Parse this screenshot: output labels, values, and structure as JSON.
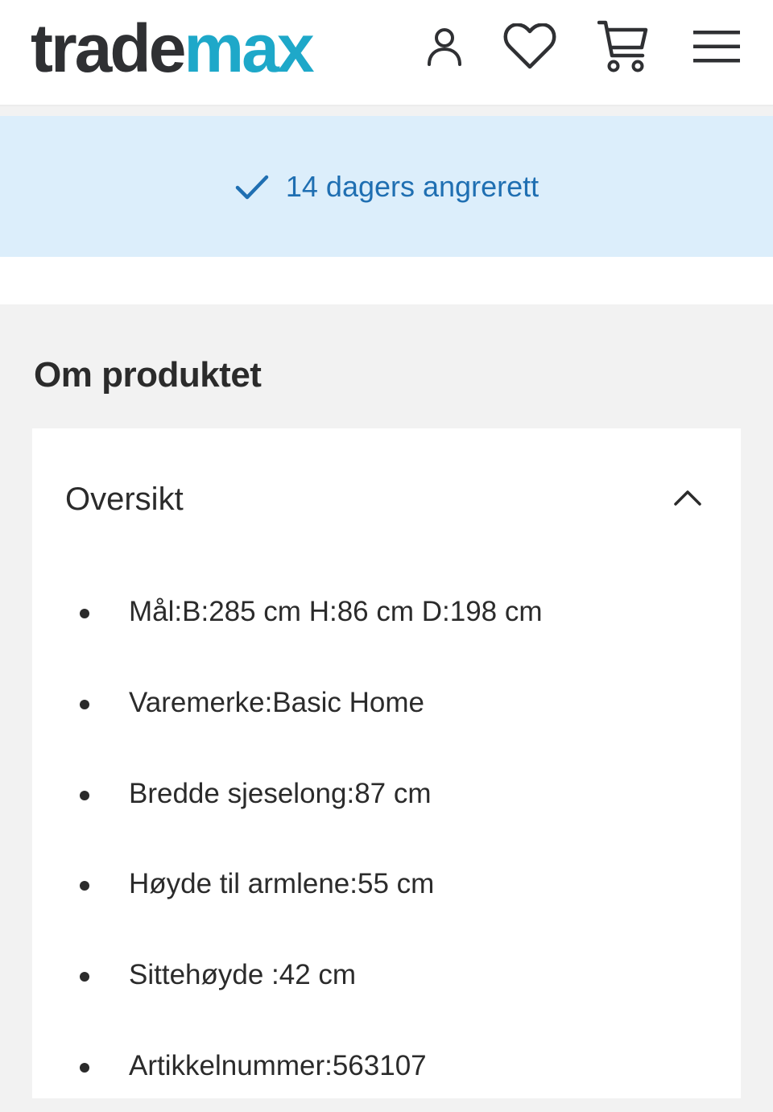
{
  "header": {
    "logo": {
      "part1": "trade",
      "part2": "max"
    },
    "icons": {
      "account": "account-icon",
      "favorites": "heart-icon",
      "cart": "cart-icon",
      "menu": "hamburger-menu-icon"
    }
  },
  "banner": {
    "icon": "checkmark-icon",
    "text": "14 dagers angrerett"
  },
  "main": {
    "section_title": "Om produktet",
    "accordion": {
      "title": "Oversikt",
      "state": "expanded",
      "items": [
        {
          "label": "Mål:B:285 cm H:86 cm D:198 cm"
        },
        {
          "label": "Varemerke:Basic Home"
        },
        {
          "label": "Bredde sjeselong:87 cm"
        },
        {
          "label": "Høyde til armlene:55 cm"
        },
        {
          "label": "Sittehøyde :42 cm"
        },
        {
          "label": "Artikkelnummer:563107"
        }
      ]
    }
  },
  "colors": {
    "brand_dark": "#2f3033",
    "brand_accent": "#1ea8c9",
    "banner_bg": "#dceefb",
    "banner_text": "#1f6fb2",
    "page_bg": "#f2f2f2"
  }
}
